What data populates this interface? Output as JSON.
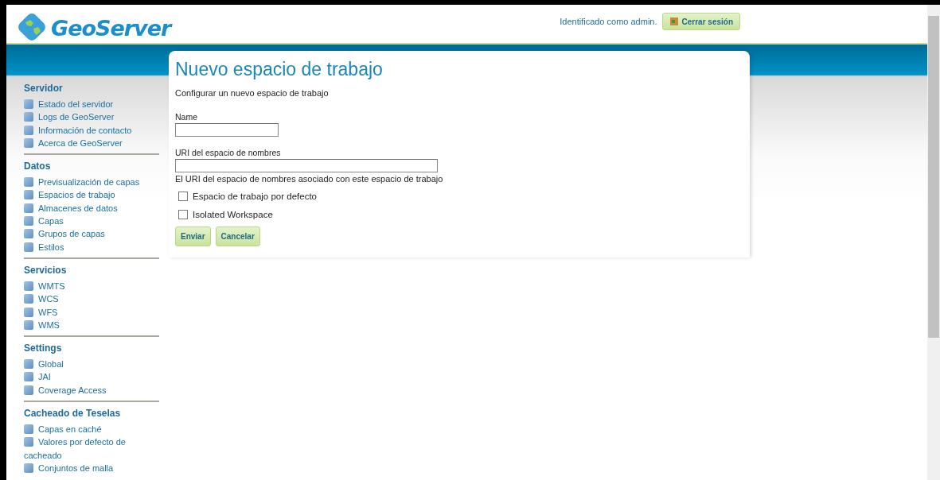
{
  "header": {
    "logo_text": "GeoServer",
    "login_status": "Identificado como admin.",
    "logout_button": "Cerrar sesión"
  },
  "sidebar": [
    {
      "title": "Servidor",
      "items": [
        "Estado del servidor",
        "Logs de GeoServer",
        "Información de contacto",
        "Acerca de GeoServer"
      ]
    },
    {
      "title": "Datos",
      "items": [
        "Previsualización de capas",
        "Espacios de trabajo",
        "Almacenes de datos",
        "Capas",
        "Grupos de capas",
        "Estilos"
      ]
    },
    {
      "title": "Servicios",
      "items": [
        "WMTS",
        "WCS",
        "WFS",
        "WMS"
      ]
    },
    {
      "title": "Settings",
      "items": [
        "Global",
        "JAI",
        "Coverage Access"
      ]
    },
    {
      "title": "Cacheado de Teselas",
      "items": [
        "Capas en caché",
        "Valores por defecto de cacheado",
        "Conjuntos de malla"
      ]
    }
  ],
  "form": {
    "title": "Nuevo espacio de trabajo",
    "description": "Configurar un nuevo espacio de trabajo",
    "fields": [
      {
        "label": "Name",
        "wide": false
      },
      {
        "label": "URI del espacio de nombres",
        "wide": true,
        "help": "El URI del espacio de nombres asociado con este espacio de trabajo"
      }
    ],
    "checkboxes": [
      {
        "label": "Espacio de trabajo por defecto",
        "checked": false
      },
      {
        "label": "Isolated Workspace",
        "checked": false
      }
    ],
    "buttons": [
      "Enviar",
      "Cancelar"
    ]
  }
}
